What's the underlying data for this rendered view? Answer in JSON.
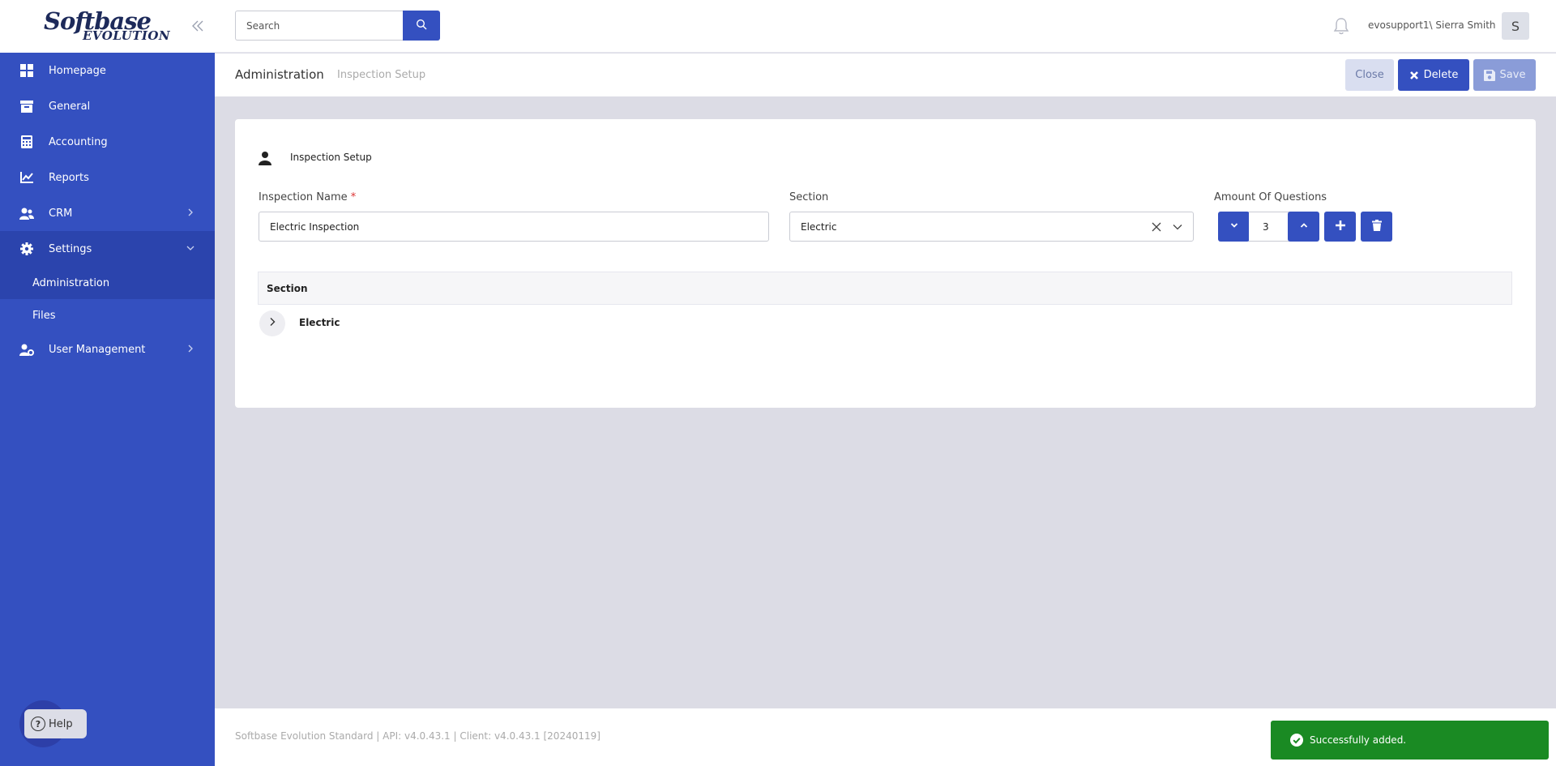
{
  "brand": {
    "line1": "Softbase",
    "line2": "EVOLUTION"
  },
  "sidebar": {
    "items": [
      {
        "label": "Homepage",
        "icon": "grid-icon"
      },
      {
        "label": "General",
        "icon": "archive-icon"
      },
      {
        "label": "Accounting",
        "icon": "calculator-icon"
      },
      {
        "label": "Reports",
        "icon": "chart-icon"
      },
      {
        "label": "CRM",
        "icon": "users-icon"
      },
      {
        "label": "Settings",
        "icon": "gear-icon"
      },
      {
        "label": "User Management",
        "icon": "user-cog-icon"
      }
    ],
    "settings_sub": [
      {
        "label": "Administration"
      },
      {
        "label": "Files"
      }
    ],
    "help_label": "Help"
  },
  "topbar": {
    "search_placeholder": "Search",
    "user": "evosupport1\\ Sierra Smith",
    "avatar_initial": "S"
  },
  "header": {
    "title": "Administration",
    "subtitle": "Inspection Setup",
    "close_label": "Close",
    "delete_label": "Delete",
    "save_label": "Save"
  },
  "form": {
    "card_title": "Inspection Setup",
    "name_label": "Inspection Name",
    "name_required": "*",
    "name_value": "Electric Inspection",
    "section_label": "Section",
    "section_value": "Electric",
    "questions_label": "Amount Of Questions",
    "questions_value": "3"
  },
  "table": {
    "header": "Section",
    "rows": [
      {
        "label": "Electric"
      }
    ]
  },
  "footer": {
    "text": "Softbase Evolution Standard | API: v4.0.43.1 | Client: v4.0.43.1 [20240119]"
  },
  "toast": {
    "message": "Successfully added."
  },
  "colors": {
    "primary": "#3450c0",
    "success": "#1a8a23",
    "background": "#dcdce5"
  }
}
